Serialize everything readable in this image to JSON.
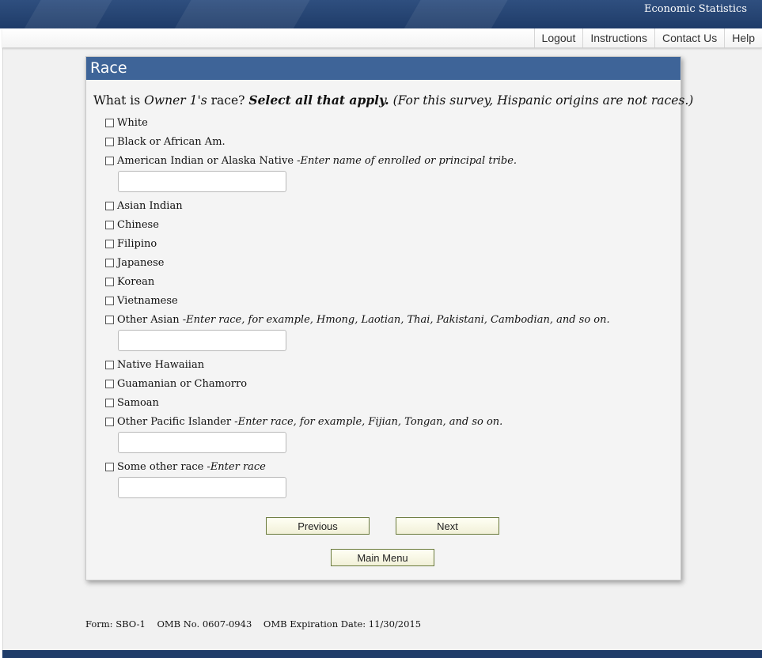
{
  "banner": {
    "title": "Economic Statistics"
  },
  "nav": {
    "logout": "Logout",
    "instructions": "Instructions",
    "contact": "Contact Us",
    "help": "Help"
  },
  "panel": {
    "title": "Race"
  },
  "question": {
    "prefix": "What is ",
    "owner": "Owner 1's",
    "middle": " race? ",
    "select_all": "Select all that apply.",
    "note": " (For this survey, Hispanic origins are not races.)"
  },
  "options": {
    "white": {
      "label": "White"
    },
    "black": {
      "label": "Black or African Am."
    },
    "aian": {
      "label": "American Indian or Alaska Native - ",
      "hint": "Enter name of enrolled or principal tribe."
    },
    "asian_indian": {
      "label": "Asian Indian"
    },
    "chinese": {
      "label": "Chinese"
    },
    "filipino": {
      "label": "Filipino"
    },
    "japanese": {
      "label": "Japanese"
    },
    "korean": {
      "label": "Korean"
    },
    "vietnamese": {
      "label": "Vietnamese"
    },
    "other_asian": {
      "label": "Other Asian - ",
      "hint": "Enter race, for example, Hmong, Laotian, Thai, Pakistani, Cambodian, and so on."
    },
    "native_hawaiian": {
      "label": "Native Hawaiian"
    },
    "guamanian": {
      "label": "Guamanian or Chamorro"
    },
    "samoan": {
      "label": "Samoan"
    },
    "other_pacific": {
      "label": "Other Pacific Islander - ",
      "hint": "Enter race, for example, Fijian, Tongan, and so on."
    },
    "some_other": {
      "label": "Some other race - ",
      "hint": "Enter race"
    }
  },
  "inputs": {
    "tribe": "",
    "other_asian": "",
    "other_pacific": "",
    "some_other": ""
  },
  "buttons": {
    "previous": "Previous",
    "next": "Next",
    "main_menu": "Main Menu"
  },
  "footer": {
    "form": "Form: SBO-1",
    "omb": "OMB No. 0607-0943",
    "expiration": "OMB Expiration Date: 11/30/2015"
  },
  "colors": {
    "banner": "#1f3c69",
    "panel_header": "#3e6498",
    "button_border": "#6a7a3c"
  }
}
